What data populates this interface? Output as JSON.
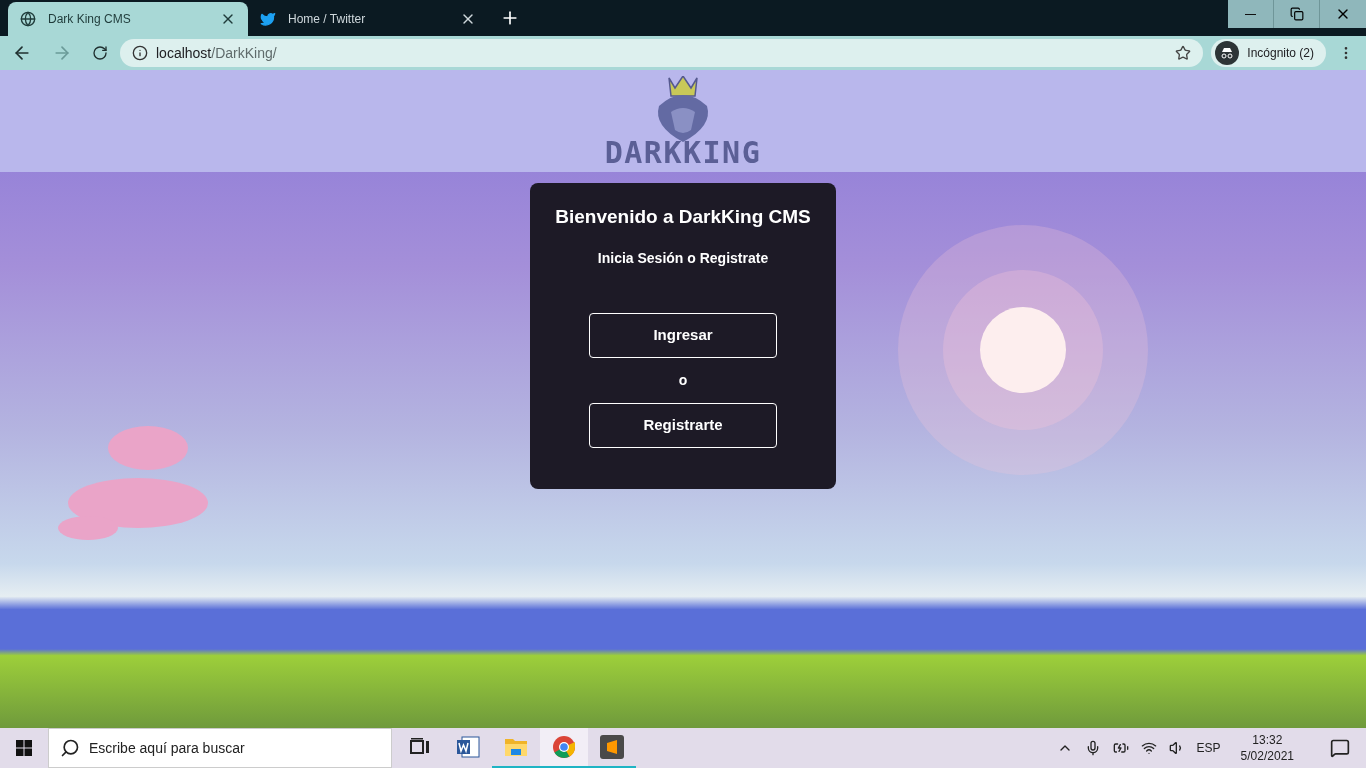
{
  "browser": {
    "tabs": [
      {
        "title": "Dark King CMS",
        "kind": "globe",
        "selected": true
      },
      {
        "title": "Home / Twitter",
        "kind": "bird",
        "selected": false
      }
    ],
    "url_host": "localhost",
    "url_path": "/DarkKing/",
    "incognito": "Incógnito (2)"
  },
  "page": {
    "logo_text": "DARKKING",
    "card": {
      "title": "Bienvenido a DarkKing CMS",
      "subtitle": "Inicia Sesión o Registrate",
      "buttons": [
        "Ingresar",
        "Registrarte"
      ],
      "separator": "o"
    }
  },
  "taskbar": {
    "search_placeholder": "Escribe aquí para buscar",
    "apps": [
      {
        "kind": "taskview",
        "running": false,
        "selected": false
      },
      {
        "kind": "word",
        "running": false,
        "selected": false
      },
      {
        "kind": "folder",
        "running": true,
        "selected": false
      },
      {
        "kind": "chrome",
        "running": true,
        "selected": true
      },
      {
        "kind": "sublime",
        "running": true,
        "selected": false
      }
    ],
    "language": "ESP",
    "time": "13:32",
    "date": "5/02/2021"
  }
}
